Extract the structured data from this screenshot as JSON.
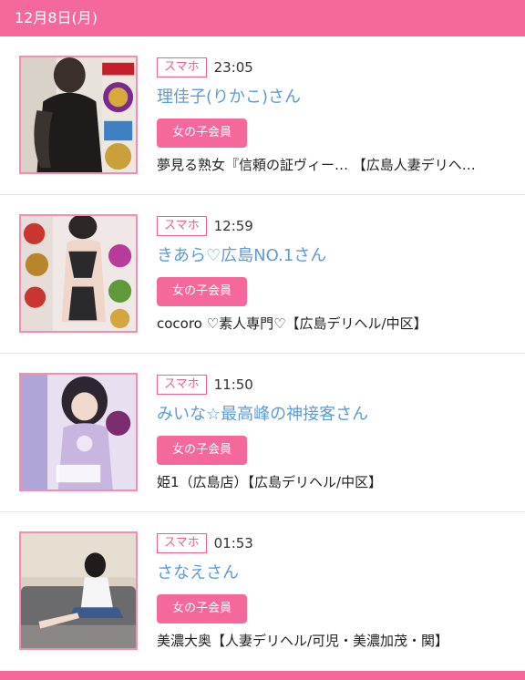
{
  "header": {
    "date": "12月8日(月)"
  },
  "entries": [
    {
      "device": "スマホ",
      "time": "23:05",
      "name": "理佳子(りかこ)さん",
      "member_label": "女の子会員",
      "shop": "夢見る熟女『信頼の証ヴィー… 【広島人妻デリヘ…"
    },
    {
      "device": "スマホ",
      "time": "12:59",
      "name": "きあら♡広島NO.1さん",
      "member_label": "女の子会員",
      "shop": "cocoro ♡素人専門♡【広島デリヘル/中区】"
    },
    {
      "device": "スマホ",
      "time": "11:50",
      "name": "みいな☆最高峰の神接客さん",
      "member_label": "女の子会員",
      "shop": "姫1（広島店）【広島デリヘル/中区】"
    },
    {
      "device": "スマホ",
      "time": "01:53",
      "name": "さなえさん",
      "member_label": "女の子会員",
      "shop": "美濃大奥【人妻デリヘル/可児・美濃加茂・関】"
    }
  ],
  "colors": {
    "accent_pink": "#f5689b",
    "badge_border": "#e9609a",
    "name_blue": "#5b9bd8",
    "thumb_border": "#f08fb4"
  }
}
